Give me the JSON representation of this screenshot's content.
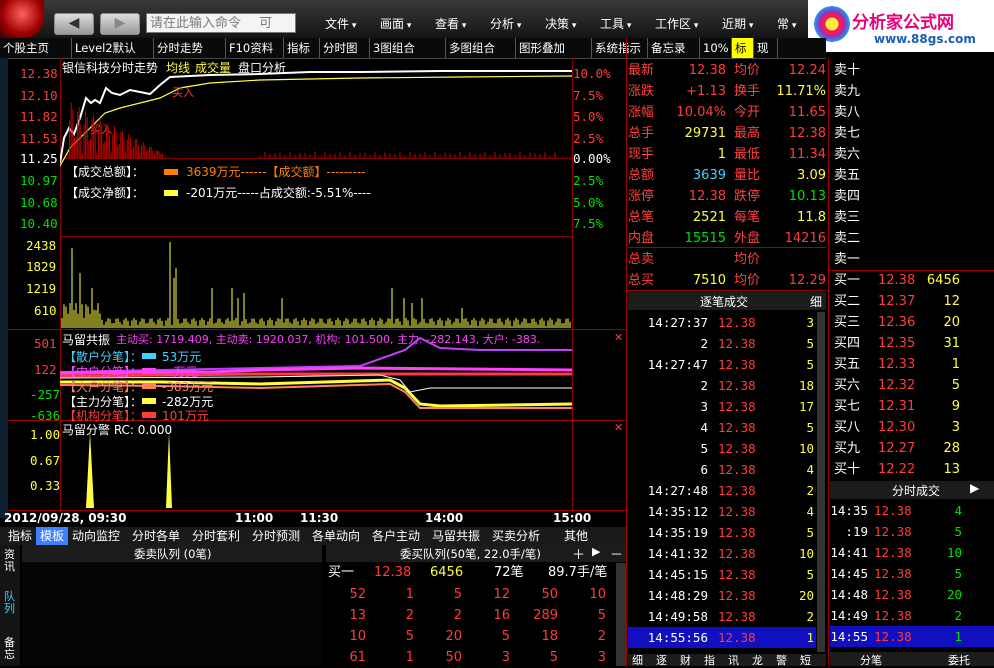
{
  "menubar": {
    "back": "◀",
    "forward": "▶",
    "command_placeholder": "请在此输入命令",
    "command_hint": "可",
    "menus": [
      "文件",
      "画面",
      "查看",
      "分析",
      "决策",
      "工具",
      "工作区",
      "近期",
      "常"
    ],
    "logo_text": "分析家公式网",
    "logo_url": "www.88gs.com"
  },
  "toolbar": {
    "items": [
      "个股主页",
      "Level2默认",
      "分时走势",
      "F10资料",
      "指标",
      "分时图",
      "3图组合",
      "多图组合",
      "图形叠加",
      "系统指示",
      "备忘录",
      "10%",
      "标",
      "现"
    ]
  },
  "chart": {
    "title": "银信科技分时走势",
    "legend": [
      "均线",
      "成交量",
      "盘口分析"
    ],
    "price_ticks": [
      "12.38",
      "12.10",
      "11.82",
      "11.53",
      "11.25",
      "10.97",
      "10.68",
      "10.40"
    ],
    "pct_ticks": [
      "10.0%",
      "7.5%",
      "5.0%",
      "2.5%",
      "0.00%",
      "2.5%",
      "5.0%",
      "7.5%"
    ],
    "vol_ticks": [
      "2438",
      "1829",
      "1219",
      "610"
    ],
    "buy_label": "买入",
    "overlay_line1_a": "【成交总额】：",
    "overlay_line1_b": "3639万元------【成交额】---------",
    "overlay_line2_a": "【成交净额】：",
    "overlay_line2_b": "-201万元-----占成交额:-5.51%----",
    "flow_header": "马留共振",
    "flow_header_detail": "主动买: 1719.409, 主动卖: 1920.037, 机构: 101.500, 主力: -282.143, 大户: -383.",
    "flow_ticks": [
      "501",
      "122",
      "-257",
      "-636"
    ],
    "flow_items": [
      {
        "label": "【散户分笔】：",
        "value": "53万元"
      },
      {
        "label": "【中户分笔】：",
        "value": "...万元"
      },
      {
        "label": "【大户分笔】：",
        "value": "-383万元"
      },
      {
        "label": "【主力分笔】：",
        "value": "-282万元"
      },
      {
        "label": "【机构分笔】：",
        "value": "101万元"
      }
    ],
    "alert_header": "马留分警 RC: 0.000",
    "alert_ticks": [
      "1.00",
      "0.67",
      "0.33"
    ],
    "time_labels": [
      "2012/09/28, 09:30",
      "11:00",
      "11:30",
      "14:00",
      "15:00"
    ]
  },
  "quote": {
    "rows": [
      {
        "l1": "最新",
        "v1": "12.38",
        "c1": "red",
        "l2": "均价",
        "v2": "12.24",
        "c2": "red"
      },
      {
        "l1": "涨跌",
        "v1": "+1.13",
        "c1": "red",
        "l2": "换手",
        "v2": "11.71%",
        "c2": "yel"
      },
      {
        "l1": "涨幅",
        "v1": "10.04%",
        "c1": "red",
        "l2": "今开",
        "v2": "11.65",
        "c2": "red"
      },
      {
        "l1": "总手",
        "v1": "29731",
        "c1": "yel",
        "l2": "最高",
        "v2": "12.38",
        "c2": "red"
      },
      {
        "l1": "现手",
        "v1": "1",
        "c1": "yel",
        "l2": "最低",
        "v2": "11.34",
        "c2": "red"
      },
      {
        "l1": "总额",
        "v1": "3639",
        "c1": "cyn",
        "l2": "量比",
        "v2": "3.09",
        "c2": "yel"
      },
      {
        "l1": "涨停",
        "v1": "12.38",
        "c1": "red",
        "l2": "跌停",
        "v2": "10.13",
        "c2": "grn"
      },
      {
        "l1": "总笔",
        "v1": "2521",
        "c1": "yel",
        "l2": "每笔",
        "v2": "11.8",
        "c2": "yel"
      },
      {
        "l1": "内盘",
        "v1": "15515",
        "c1": "grn",
        "l2": "外盘",
        "v2": "14216",
        "c2": "red"
      },
      {
        "l1": "总卖",
        "v1": "",
        "c1": "yel",
        "l2": "均价",
        "v2": "",
        "c2": "yel"
      },
      {
        "l1": "总买",
        "v1": "7510",
        "c1": "yel",
        "l2": "均价",
        "v2": "12.29",
        "c2": "red"
      }
    ]
  },
  "orderbook": {
    "sells": [
      "卖十",
      "卖九",
      "卖八",
      "卖七",
      "卖六",
      "卖五",
      "卖四",
      "卖三",
      "卖二",
      "卖一"
    ],
    "buys": [
      {
        "n": "买一",
        "p": "12.38",
        "v": "6456"
      },
      {
        "n": "买二",
        "p": "12.37",
        "v": "12"
      },
      {
        "n": "买三",
        "p": "12.36",
        "v": "20"
      },
      {
        "n": "买四",
        "p": "12.35",
        "v": "31"
      },
      {
        "n": "买五",
        "p": "12.33",
        "v": "1"
      },
      {
        "n": "买六",
        "p": "12.32",
        "v": "5"
      },
      {
        "n": "买七",
        "p": "12.31",
        "v": "9"
      },
      {
        "n": "买八",
        "p": "12.30",
        "v": "3"
      },
      {
        "n": "买九",
        "p": "12.27",
        "v": "28"
      },
      {
        "n": "买十",
        "p": "12.22",
        "v": "13"
      }
    ]
  },
  "ticks": {
    "title": "逐笔成交",
    "tail": "细",
    "rows": [
      {
        "t": "14:27:37",
        "p": "12.38",
        "v": "3"
      },
      {
        "t": "2",
        "p": "12.38",
        "v": "5"
      },
      {
        "t": "14:27:47",
        "p": "12.38",
        "v": "5"
      },
      {
        "t": "2",
        "p": "12.38",
        "v": "18"
      },
      {
        "t": "3",
        "p": "12.38",
        "v": "17"
      },
      {
        "t": "4",
        "p": "12.38",
        "v": "5"
      },
      {
        "t": "5",
        "p": "12.38",
        "v": "10"
      },
      {
        "t": "6",
        "p": "12.38",
        "v": "4"
      },
      {
        "t": "14:27:48",
        "p": "12.38",
        "v": "2"
      },
      {
        "t": "14:35:12",
        "p": "12.38",
        "v": "4"
      },
      {
        "t": "14:35:19",
        "p": "12.38",
        "v": "5"
      },
      {
        "t": "14:41:32",
        "p": "12.38",
        "v": "10"
      },
      {
        "t": "14:45:15",
        "p": "12.38",
        "v": "5"
      },
      {
        "t": "14:48:29",
        "p": "12.38",
        "v": "20"
      },
      {
        "t": "14:49:58",
        "p": "12.38",
        "v": "2"
      },
      {
        "t": "14:55:56",
        "p": "12.38",
        "v": "1"
      }
    ]
  },
  "minute_trades": {
    "title": "分时成交",
    "rows": [
      {
        "t": "14:35",
        "p": "12.38",
        "v": "4"
      },
      {
        "t": ":19",
        "p": "12.38",
        "v": "5"
      },
      {
        "t": "14:41",
        "p": "12.38",
        "v": "10"
      },
      {
        "t": "14:45",
        "p": "12.38",
        "v": "5"
      },
      {
        "t": "14:48",
        "p": "12.38",
        "v": "20"
      },
      {
        "t": "14:49",
        "p": "12.38",
        "v": "2"
      },
      {
        "t": "14:55",
        "p": "12.38",
        "v": "1"
      }
    ],
    "bottom_tabs": [
      "分笔",
      "委托"
    ]
  },
  "bottom": {
    "tabs": [
      "指标",
      "模板",
      "动向监控",
      "分时各单",
      "分时套利",
      "分时预测",
      "各单动向",
      "各户主动",
      "马留共振",
      "买卖分析",
      "其他"
    ],
    "side_tabs": [
      "资讯",
      "队列",
      "备忘"
    ],
    "sell_queue_title": "委卖队列 (0笔)",
    "buy_queue_title": "委买队列(50笔, 22.0手/笔)",
    "buy1": {
      "label": "买一",
      "price": "12.38",
      "vol": "6456",
      "count": "72笔",
      "avg": "89.7手/笔"
    },
    "queue_rows": [
      [
        "52",
        "1",
        "5",
        "12",
        "50",
        "10"
      ],
      [
        "13",
        "2",
        "2",
        "16",
        "289",
        "5"
      ],
      [
        "10",
        "5",
        "20",
        "5",
        "18",
        "2"
      ],
      [
        "61",
        "1",
        "50",
        "3",
        "5",
        "3"
      ]
    ],
    "right_tabs": [
      "细",
      "逐",
      "财",
      "指",
      "讯",
      "龙",
      "警",
      "短"
    ]
  },
  "colors": {
    "up": "#ff3b3b",
    "down": "#00e000",
    "grid": "#8a0000",
    "accent": "#ffff40"
  }
}
